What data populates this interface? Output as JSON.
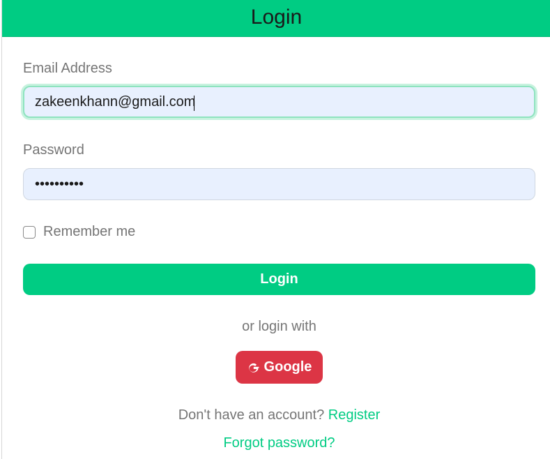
{
  "header": {
    "title": "Login"
  },
  "form": {
    "email_label": "Email Address",
    "email_value": "zakeenkhann@gmail.com",
    "password_label": "Password",
    "password_mask": "••••••••••",
    "remember_label": "Remember me",
    "remember_checked": false,
    "login_button": "Login"
  },
  "social": {
    "divider_text": "or login with",
    "google_label": "Google",
    "google_icon": "google-g-icon"
  },
  "footer": {
    "no_account_text": "Don't have an account?",
    "register_link": "Register",
    "forgot_link": "Forgot password?"
  },
  "colors": {
    "accent": "#00cc83",
    "google": "#dc3545",
    "input_bg": "#e8f0fe",
    "label": "#757575"
  }
}
